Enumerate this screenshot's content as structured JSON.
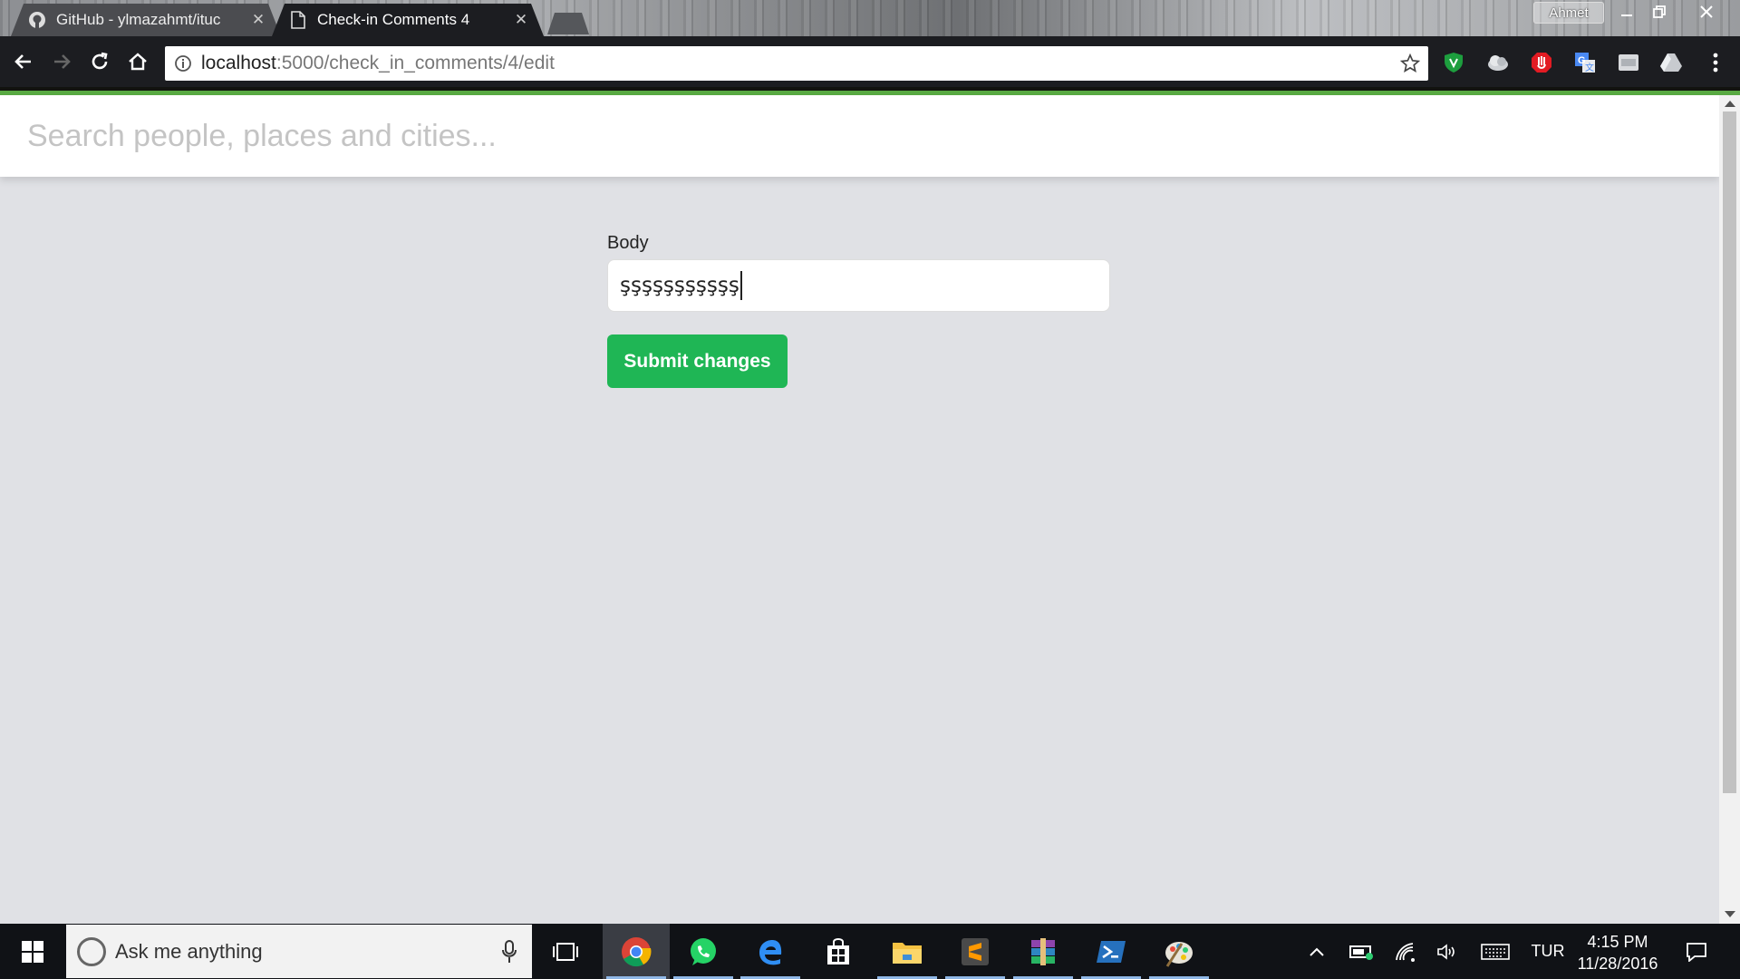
{
  "browser": {
    "tabs": [
      {
        "title": "GitHub - ylmazahmt/ituc",
        "icon": "github-icon",
        "active": false
      },
      {
        "title": "Check-in Comments 4",
        "icon": "document-icon",
        "active": true
      }
    ],
    "profile_name": "Ahmet",
    "url_host": "localhost",
    "url_path": ":5000/check_in_comments/4/edit",
    "accent": "#58a942"
  },
  "page": {
    "search_placeholder": "Search people, places and cities...",
    "body_label": "Body",
    "body_value": "şşşşşşşşşşş",
    "submit_label": "Submit changes",
    "submit_color": "#1fb655"
  },
  "taskbar": {
    "search_text": "Ask me anything",
    "apps": [
      "task-view-icon",
      "chrome-icon",
      "whatsapp-icon",
      "edge-icon",
      "store-icon",
      "file-explorer-icon",
      "sublime-text-icon",
      "winrar-icon",
      "powershell-icon",
      "paint-icon"
    ],
    "language": "TUR",
    "time": "4:15 PM",
    "date": "11/28/2016"
  }
}
